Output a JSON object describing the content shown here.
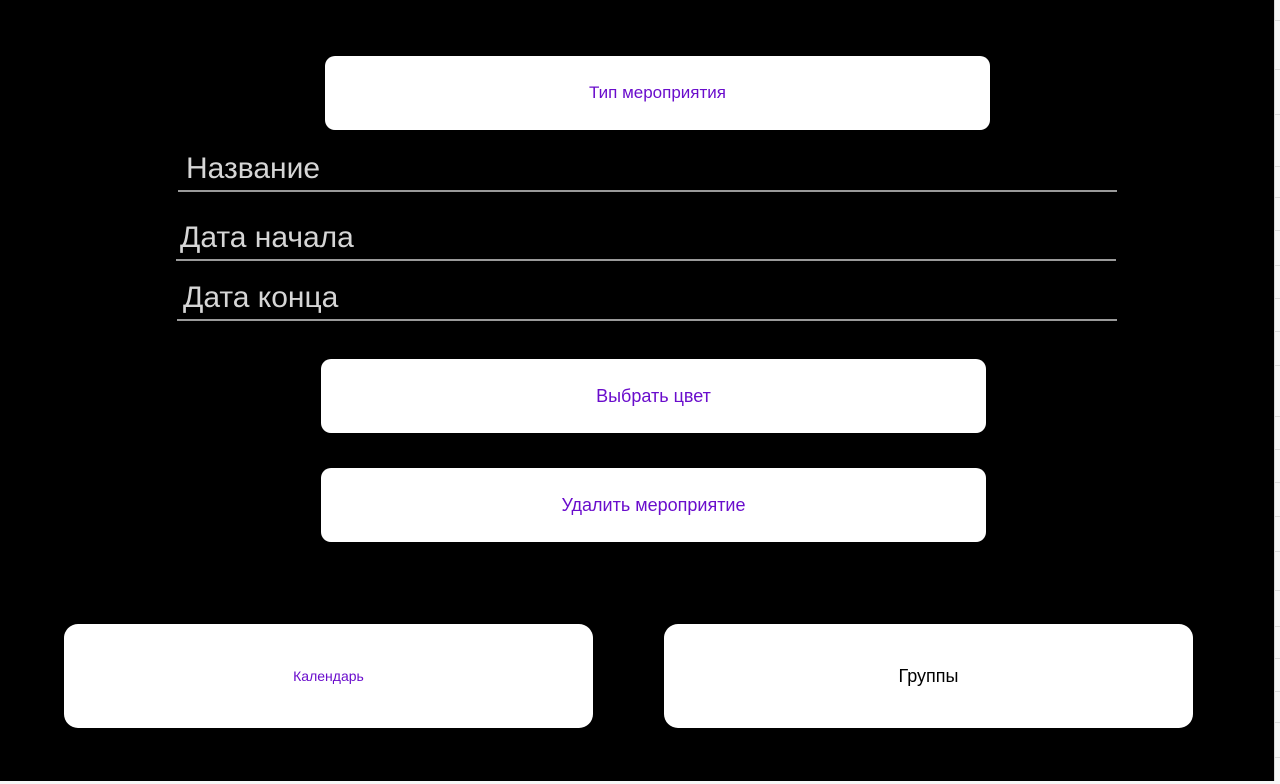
{
  "event_form": {
    "type_button_label": "Тип мероприятия",
    "name_placeholder": "Название",
    "start_date_placeholder": "Дата начала",
    "end_date_placeholder": "Дата конца",
    "color_button_label": "Выбрать цвет",
    "delete_button_label": "Удалить мероприятие"
  },
  "bottom_nav": {
    "calendar_label": "Календарь",
    "groups_label": "Группы"
  },
  "colors": {
    "background": "#000000",
    "button_background": "#ffffff",
    "accent_text": "#6a0dcc",
    "field_text": "#d6d6d6",
    "field_underline": "#9a9a9a"
  }
}
